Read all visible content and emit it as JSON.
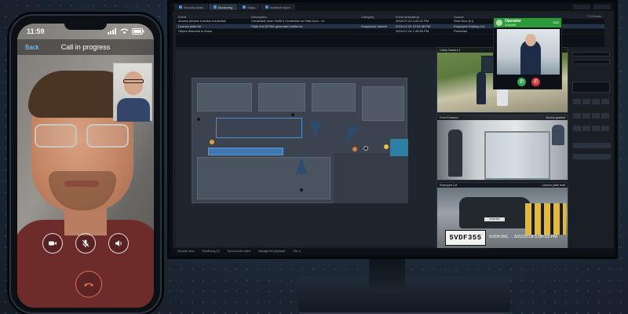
{
  "phone": {
    "time": "11:59",
    "nav_back": "Back",
    "nav_title": "Call in progress",
    "controls": [
      "video-icon",
      "mute-mic-icon",
      "speaker-icon"
    ],
    "end_call_icon": "end-call-icon",
    "end_call_color": "#e36e4e"
  },
  "app": {
    "tabs": [
      {
        "label": "Security Desk",
        "active": false
      },
      {
        "label": "Monitoring",
        "active": true
      },
      {
        "label": "Maps",
        "active": false
      },
      {
        "label": "Incident report",
        "active": false
      }
    ],
    "event_table": {
      "count": "7/13 items",
      "headers": [
        "Event",
        "Description",
        "Category",
        "Event timestamp",
        "Source"
      ],
      "rows": [
        {
          "event": "Access denied: Inactive credential",
          "description": "Credential Jane Smith's Credential on Side Door - In",
          "category": "",
          "timestamp": "2018-07-23 3:23:22 PM",
          "source": "Side Door (In)",
          "selected": false
        },
        {
          "event": "License plate hit",
          "description": "Plate 5VLDF355 generated hotlist hit",
          "category": "Suspicious Vehicle",
          "timestamp": "2018-07-24 12:06:48 PM",
          "source": "Employee Parking Lot",
          "selected": true
        },
        {
          "event": "Object detected in fence",
          "description": "",
          "category": "",
          "timestamp": "2018-07-24 1:49:55 PM",
          "source": "Perimeter",
          "selected": false
        }
      ]
    },
    "video_tiles": [
      {
        "label": "Lobby Camera 1"
      },
      {
        "label": "Front Entrance",
        "badge": "Access granted"
      },
      {
        "label": "Employee Lot",
        "badge": "Licence plate read"
      }
    ],
    "plate": {
      "text": "5VDF355",
      "info": "5VDF355, -, 3/22/2018 5:05:53 PM"
    },
    "call_card": {
      "title": "Operator",
      "subtitle": "Available",
      "id": "1102",
      "accept_icon": "accept-call-icon",
      "decline_icon": "decline-call-icon",
      "accept_color": "#2ea44f",
      "decline_color": "#d2333a"
    },
    "statusbar": [
      "Security desk",
      "Monitoring (1)",
      "Synchronize video",
      "Manage the playback",
      "Tile: 4"
    ],
    "accent_color": "#2d9a3a"
  }
}
